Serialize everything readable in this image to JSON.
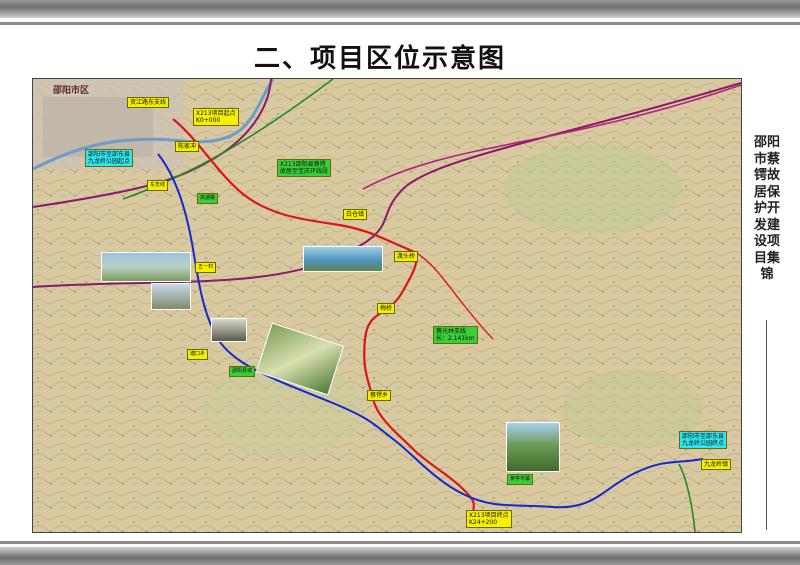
{
  "title": "二、项目区位示意图",
  "side_title": "邵阳市蔡锷故居保护开发建设项目集锦",
  "map": {
    "city_label": "邵阳市区",
    "labels": {
      "route_start": "X213项目起点\nK0+000",
      "route_end": "X213项目终点\nK24+200",
      "branch_note": "X213邵阳县蔡锷\n故居至宝庆环线段",
      "branch_length": "蔡光林支线\n长：2.141km",
      "scenic_start": "邵阳市至邵东县\n九龙岭公园起点",
      "scenic_end": "邵阳市至邵东县\n九龙岭公园终点",
      "town_1": "资江路东支线",
      "town_2": "陈家冲",
      "town_3": "白仓镇",
      "town_4": "渡头桥",
      "town_5": "梅桥",
      "town_6": "蔡锷乡",
      "town_7": "九龙岭镇",
      "small_1": "高速路",
      "small_2": "五一村",
      "small_3": "塘口乡",
      "small_4": "邵阳县城",
      "small_5": "黄亭市镇",
      "small_6": "东支线"
    }
  },
  "colors": {
    "terrain": "#d8c8a0",
    "red_route": "#d81818",
    "blue_route": "#1428d0",
    "purple_road": "#8a1a6a",
    "green_rail": "#1f8a2a"
  }
}
